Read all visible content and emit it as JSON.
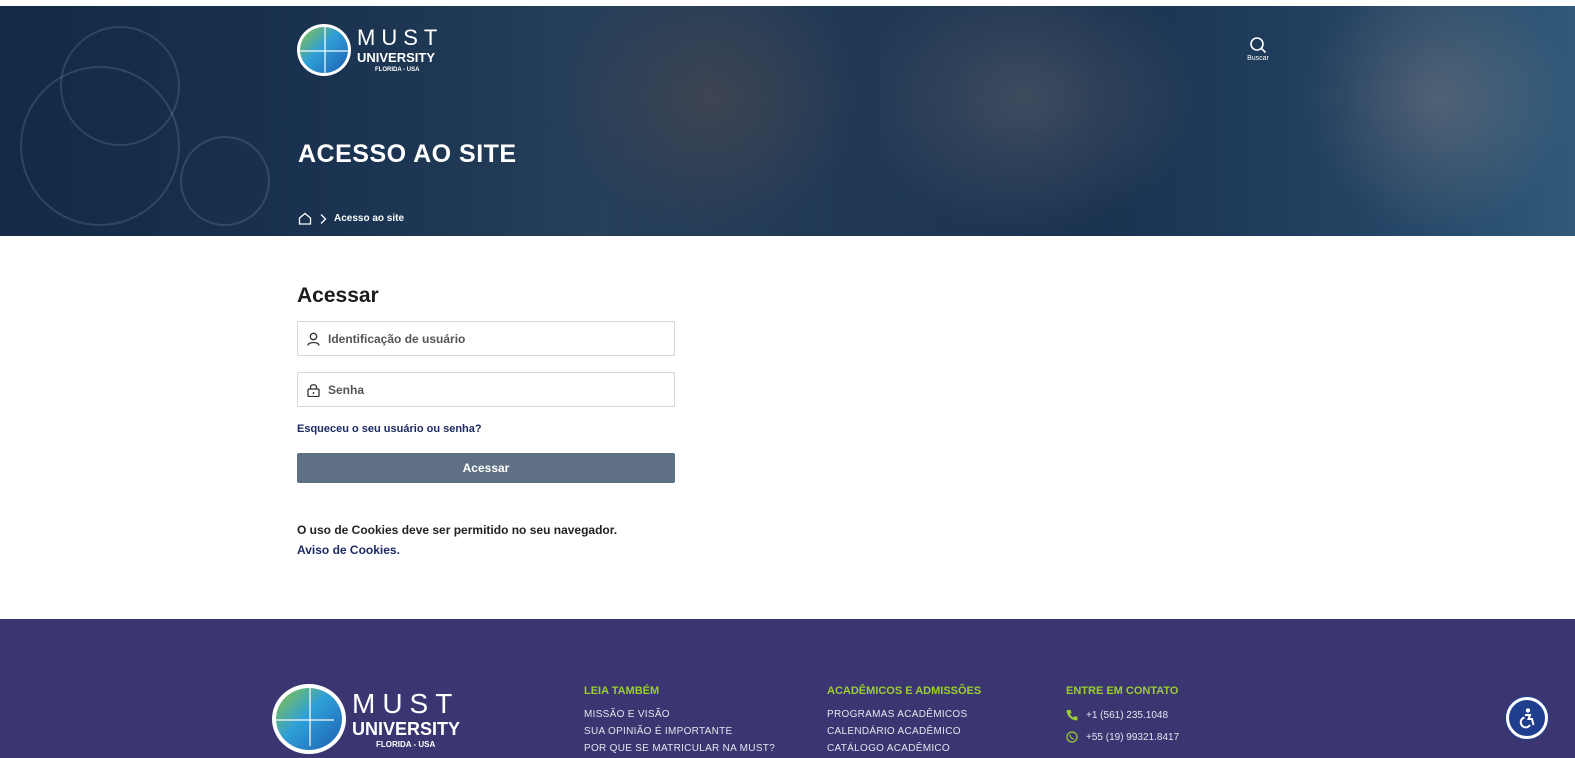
{
  "hero": {
    "logo": {
      "must": "MUST",
      "university": "UNIVERSITY",
      "location": "FLORIDA - USA"
    },
    "search_label": "Buscar",
    "title": "ACESSO AO SITE",
    "breadcrumb": {
      "current": "Acesso ao site"
    }
  },
  "login": {
    "heading": "Acessar",
    "username_placeholder": "Identificação de usuário",
    "password_placeholder": "Senha",
    "forgot_link": "Esqueceu o seu usuário ou senha?",
    "submit_label": "Acessar",
    "cookie_note": "O uso de Cookies deve ser permitido no seu navegador.",
    "cookie_link": "Aviso de Cookies."
  },
  "footer": {
    "logo": {
      "must": "MUST",
      "university": "UNIVERSITY",
      "location": "FLORIDA - USA"
    },
    "col1": {
      "heading": "LEIA TAMBÉM",
      "links": [
        "MISSÃO E VISÃO",
        "SUA OPINIÃO É IMPORTANTE",
        "POR QUE SE MATRICULAR NA MUST?"
      ]
    },
    "col2": {
      "heading": "ACADÊMICOS E ADMISSÕES",
      "links": [
        "PROGRAMAS ACADÊMICOS",
        "CALENDÁRIO ACADÊMICO",
        "CATÁLOGO ACADÊMICO"
      ]
    },
    "col3": {
      "heading": "ENTRE EM CONTATO",
      "phone": "+1 (561) 235.1048",
      "whatsapp": "+55 (19) 99321.8417"
    }
  },
  "colors": {
    "footer_bg": "#3b3671",
    "footer_heading": "#9acd32",
    "button": "#5f7085",
    "link": "#1e2a66"
  },
  "icons": [
    "home-icon",
    "chevron-right-icon",
    "search-icon",
    "user-icon",
    "lock-icon",
    "phone-icon",
    "whatsapp-icon",
    "accessibility-icon"
  ]
}
